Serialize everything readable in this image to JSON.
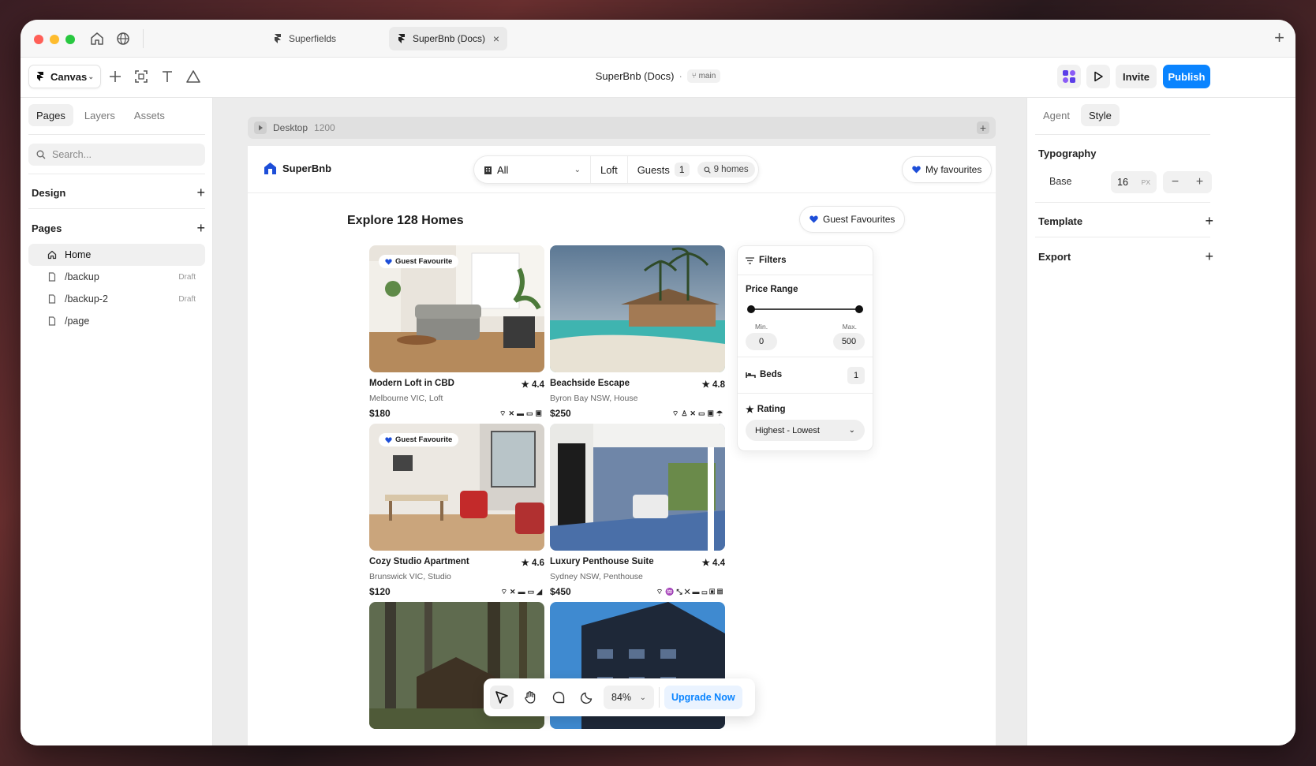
{
  "window": {
    "tabs": [
      {
        "label": "Superfields"
      },
      {
        "label": "SuperBnb (Docs)"
      }
    ]
  },
  "toolbar": {
    "canvas_label": "Canvas",
    "doc_title": "SuperBnb (Docs)",
    "branch": "main",
    "invite_label": "Invite",
    "publish_label": "Publish",
    "publish_color": "#0a84ff"
  },
  "left_panel": {
    "tabs": [
      {
        "label": "Pages"
      },
      {
        "label": "Layers"
      },
      {
        "label": "Assets"
      }
    ],
    "search_placeholder": "Search...",
    "design_label": "Design",
    "pages_label": "Pages",
    "pages": [
      {
        "label": "Home",
        "badge": ""
      },
      {
        "label": "/backup",
        "badge": "Draft"
      },
      {
        "label": "/backup-2",
        "badge": "Draft"
      },
      {
        "label": "/page",
        "badge": ""
      }
    ]
  },
  "canvas": {
    "frame_name": "Desktop",
    "frame_width": "1200",
    "site": {
      "brand": "SuperBnb",
      "search": {
        "type_value": "All",
        "location": "Loft",
        "guests_label": "Guests",
        "guests_count": "1",
        "homes_count": "9 homes"
      },
      "my_favourites": "My favourites",
      "heading": "Explore 128 Homes",
      "guest_favourites_btn": "Guest Favourites",
      "badge_label": "Guest Favourite",
      "listings": [
        {
          "title": "Modern Loft in CBD",
          "rating": "4.4",
          "location": "Melbourne VIC, Loft",
          "price": "$180",
          "guest_fav": true
        },
        {
          "title": "Beachside Escape",
          "rating": "4.8",
          "location": "Byron Bay NSW, House",
          "price": "$250",
          "guest_fav": false
        },
        {
          "title": "Cozy Studio Apartment",
          "rating": "4.6",
          "location": "Brunswick VIC, Studio",
          "price": "$120",
          "guest_fav": true
        },
        {
          "title": "Luxury Penthouse Suite",
          "rating": "4.4",
          "location": "Sydney NSW, Penthouse",
          "price": "$450",
          "guest_fav": false
        }
      ],
      "filters": {
        "title": "Filters",
        "price_range_label": "Price Range",
        "min_label": "Min.",
        "max_label": "Max.",
        "min_value": "0",
        "max_value": "500",
        "beds_label": "Beds",
        "beds_value": "1",
        "rating_label": "Rating",
        "rating_sort": "Highest - Lowest"
      }
    },
    "bottom_bar": {
      "zoom": "84%",
      "upgrade_label": "Upgrade Now",
      "upgrade_color": "#0a84ff"
    }
  },
  "right_panel": {
    "tabs": [
      {
        "label": "Agent"
      },
      {
        "label": "Style"
      }
    ],
    "typography_label": "Typography",
    "base_label": "Base",
    "base_value": "16",
    "base_unit": "PX",
    "template_label": "Template",
    "export_label": "Export"
  },
  "colors": {
    "brand_blue": "#1d4ed8",
    "accent": "#0a84ff"
  }
}
